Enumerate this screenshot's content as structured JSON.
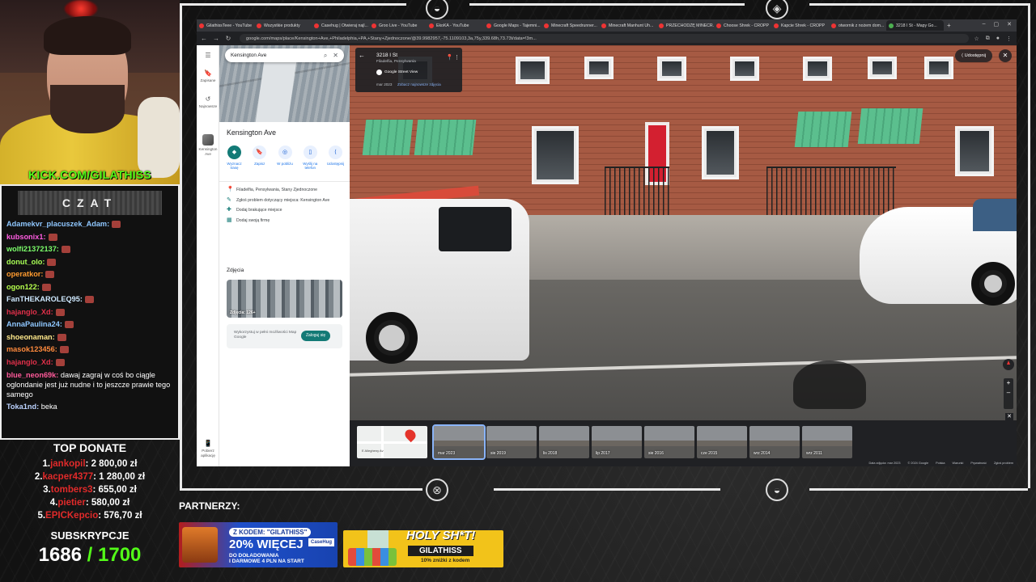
{
  "overlay": {
    "kick_url": "KICK.COM/GILATHISS",
    "chat_title": "CZAT",
    "chat": [
      {
        "user": "Adamekvr_placuszek_Adam:",
        "color": "#8fc7ff",
        "text": ""
      },
      {
        "user": "kubsonix1:",
        "color": "#ff5ce1",
        "text": ""
      },
      {
        "user": "wolfi21372137:",
        "color": "#7cff6b",
        "text": ""
      },
      {
        "user": "donut_olo:",
        "color": "#a8ff55",
        "text": ""
      },
      {
        "user": "operatkor:",
        "color": "#ff9b2f",
        "text": ""
      },
      {
        "user": "ogon122:",
        "color": "#b6ff4d",
        "text": ""
      },
      {
        "user": "FanTHEKAROLEQ95:",
        "color": "#cfe9ff",
        "text": ""
      },
      {
        "user": "hajanglo_Xd:",
        "color": "#e0304a",
        "text": ""
      },
      {
        "user": "AnnaPaulina24:",
        "color": "#8fc7ff",
        "text": ""
      },
      {
        "user": "shoeonaman:",
        "color": "#ffe88a",
        "text": ""
      },
      {
        "user": "masok123456:",
        "color": "#ff8a3d",
        "text": ""
      },
      {
        "user": "hajanglo_Xd:",
        "color": "#e0304a",
        "text": ""
      },
      {
        "user": "blue_neon69k:",
        "color": "#ff5a9a",
        "text": "dawaj zagraj w coś bo ciągle oglondanie jest już nudne i to jeszcze prawie tego samego"
      },
      {
        "user": "Toka1nd:",
        "color": "#bcd3ff",
        "text": "beka"
      }
    ],
    "top_donate_title": "TOP DONATE",
    "donations": [
      {
        "rank": "1.",
        "name": "jankopil",
        "amount": ": 2 800,00 zł"
      },
      {
        "rank": "2.",
        "name": "kacper4377",
        "amount": ": 1 280,00 zł"
      },
      {
        "rank": "3.",
        "name": "tombers3",
        "amount": ": 655,00 zł"
      },
      {
        "rank": "4.",
        "name": "pietier",
        "amount": ": 580,00 zł"
      },
      {
        "rank": "5.",
        "name": "EPICKepcio",
        "amount": ": 576,70 zł"
      }
    ],
    "subs_title": "SUBSKRYPCJE",
    "subs_current": "1686",
    "subs_goal": "/ 1700",
    "partners_label": "PARTNERZY:",
    "banner1": {
      "code": "Z KODEM: \"GILATHISS\"",
      "big": "20% WIĘCEJ",
      "line2": "DO DOŁADOWANIA",
      "line3": "I DARMOWE 4 PLN NA START",
      "brand": "CaseHug"
    },
    "banner2": {
      "head": "HOLY SH*T!",
      "name": "GILATHISS",
      "disc": "10% zniżki z kodem"
    }
  },
  "browser": {
    "tabs": [
      {
        "label": "GilathissTeee - YouTube",
        "active": false
      },
      {
        "label": "Wszystkie produkty",
        "active": false
      },
      {
        "label": "Casehug | Otwieraj najl...",
        "active": false
      },
      {
        "label": "Groo Live - YouTube",
        "active": false
      },
      {
        "label": "EkoKA - YouTube",
        "active": false
      },
      {
        "label": "Google Maps - Tajemni...",
        "active": false
      },
      {
        "label": "Minecraft Speedrunner...",
        "active": false
      },
      {
        "label": "Minecraft Manhunt Uh...",
        "active": false
      },
      {
        "label": "PRZECHODZĘ MINECR...",
        "active": false
      },
      {
        "label": "Choose Shrek - CROPP",
        "active": false
      },
      {
        "label": "Kapcie Shrek - CROPP",
        "active": false
      },
      {
        "label": "otwornik z nożem dom...",
        "active": false
      },
      {
        "label": "3218 I St - Mapy Go...",
        "active": true
      }
    ],
    "url": "google.com/maps/place/Kensington+Ave,+Philadelphia,+PA,+Stany+Zjednoczone/@39.9982957,-75.1109103,3a,75y,339.68h,73.73t/data=!3m..."
  },
  "maps": {
    "rail": [
      {
        "icon": "☰",
        "label": ""
      },
      {
        "icon": "🔖",
        "label": "Zapisane"
      },
      {
        "icon": "↺",
        "label": "Najnowsze"
      },
      {
        "icon": "",
        "label": "Kensington Ave"
      },
      {
        "icon": "📱",
        "label": "Pobierz aplikację"
      }
    ],
    "search_value": "Kensington Ave",
    "place_title": "Kensington Ave",
    "actions": [
      {
        "icon": "◆",
        "label": "Wyznacz trasę"
      },
      {
        "icon": "🔖",
        "label": "Zapisz"
      },
      {
        "icon": "◎",
        "label": "W pobliżu"
      },
      {
        "icon": "▯",
        "label": "Wyślij na telefon"
      },
      {
        "icon": "⟨",
        "label": "Udostępnij"
      }
    ],
    "info": [
      {
        "icon": "📍",
        "text": "Filadelfia, Pensylwania, Stany Zjednoczone"
      },
      {
        "icon": "✎",
        "text": "Zgłoś problem dotyczący miejsca: Kensington Ave"
      },
      {
        "icon": "✚",
        "text": "Dodaj brakujące miejsce"
      },
      {
        "icon": "▦",
        "text": "Dodaj swoją firmę"
      }
    ],
    "photos_title": "Zdjęcia",
    "photos_label": "Zdjęcia: 126+",
    "login_text": "Wykorzystuj w pełni możliwości Map Google",
    "login_button": "Zaloguj się"
  },
  "streetview": {
    "address": "3218 I St",
    "location": "Filadelfia, Pensylwania",
    "brand": "Google Street View",
    "date": "mar 2023",
    "latest_link": "Zobacz najnowsze zdjęcia",
    "share": "Udostępnij",
    "map_label": "E Allegheny Av",
    "timeline": [
      "mar 2023",
      "sie 2019",
      "lis 2018",
      "lip 2017",
      "sie 2016",
      "cze 2015",
      "wrz 2014",
      "wrz 2011"
    ],
    "footer": [
      "Data zdjęcia: mar 2023",
      "© 2024 Google",
      "Polska",
      "Warunki",
      "Prywatność",
      "Zgłoś problem"
    ]
  }
}
